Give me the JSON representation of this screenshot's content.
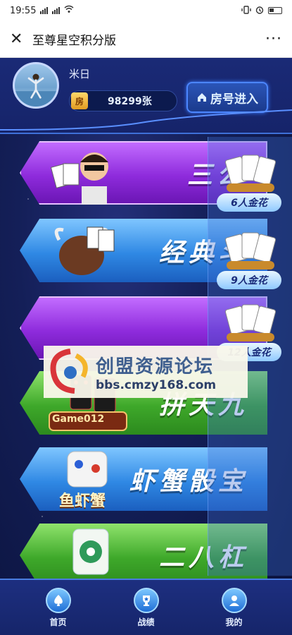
{
  "status_bar": {
    "time": "19:55",
    "signal_text": "..ıl ..ıl",
    "battery": ""
  },
  "title_bar": {
    "close_icon": "close-icon",
    "title": "至尊星空积分版",
    "more_icon": "more-icon",
    "more": "···"
  },
  "profile": {
    "username": "米日",
    "coin_label": "房",
    "coins": "98299张",
    "join_room": "房号进入"
  },
  "games": [
    {
      "label": "三公",
      "color": "purple"
    },
    {
      "label": "经典斗",
      "color": "blue"
    },
    {
      "label": "",
      "color": "purple"
    },
    {
      "label": "拼天九",
      "color": "green"
    },
    {
      "label": "虾蟹骰宝",
      "color": "blue"
    },
    {
      "label": "二八杠",
      "color": "green"
    }
  ],
  "side_games": [
    {
      "label": "6人金花"
    },
    {
      "label": "9人金花"
    },
    {
      "label": "12人金花"
    }
  ],
  "art_text": {
    "game012": "Game012",
    "fish_shrimp_crab": "鱼虾蟹"
  },
  "watermark": {
    "title": "创盟资源论坛",
    "url": "bbs.cmzy168.com"
  },
  "bottom_nav": [
    {
      "label": "首页",
      "icon": "spade-icon"
    },
    {
      "label": "战绩",
      "icon": "trophy-icon"
    },
    {
      "label": "我的",
      "icon": "user-icon"
    }
  ],
  "colors": {
    "accent": "#4a7de0",
    "purple": "#8e2bdc",
    "blue": "#2f88e4",
    "green": "#3ea82a"
  }
}
